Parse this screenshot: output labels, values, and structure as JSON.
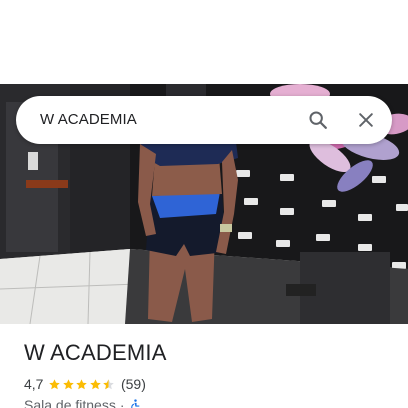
{
  "search": {
    "query": "W ACADEMIA"
  },
  "place": {
    "name": "W ACADEMIA",
    "rating": "4,7",
    "stars": 4.5,
    "reviews": "(59)",
    "category": "Sala de fitness",
    "separator": "·",
    "category_icon": "accessible-icon"
  },
  "colors": {
    "star": "#fbbc04",
    "icon_blue": "#1a73e8",
    "text": "#202124",
    "secondary": "#5f6368"
  },
  "icons": {
    "search": "search-icon",
    "close": "close-icon"
  }
}
